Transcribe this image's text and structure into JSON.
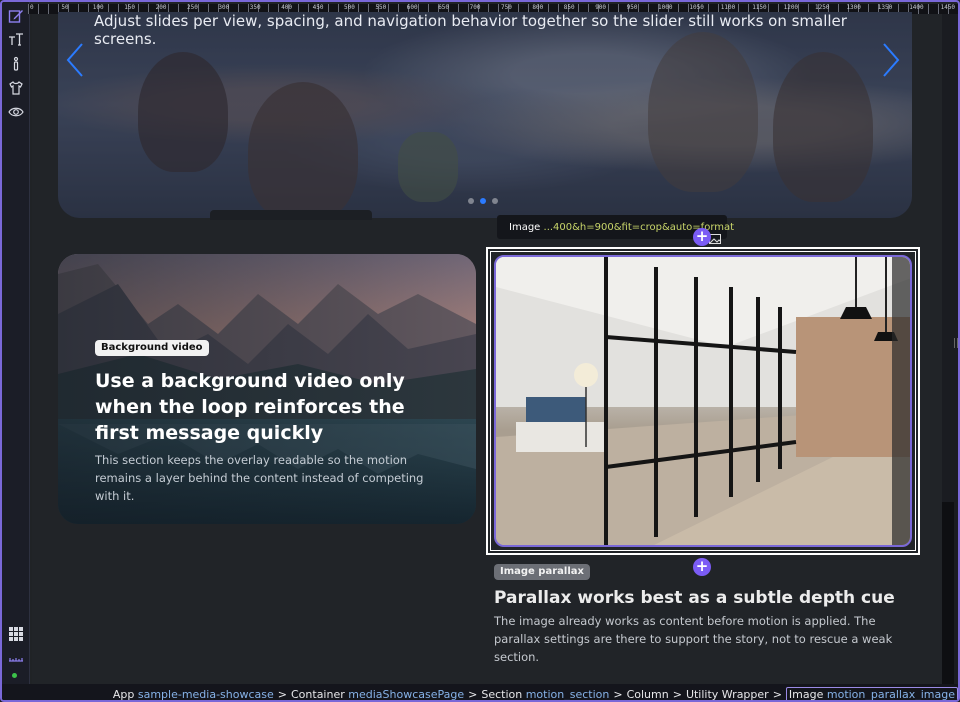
{
  "toolbar": {
    "tools": [
      {
        "icon": "edit-icon"
      },
      {
        "icon": "typography-icon"
      },
      {
        "icon": "info-icon"
      },
      {
        "icon": "shirt-icon"
      },
      {
        "icon": "eye-icon"
      }
    ],
    "bottom_tools": [
      {
        "icon": "grid-icon"
      },
      {
        "icon": "ruler-icon"
      }
    ],
    "accent": "#7a68d8"
  },
  "ruler": {
    "labels": [
      "0",
      "50",
      "100",
      "150",
      "200",
      "250",
      "300",
      "350",
      "400",
      "450",
      "500",
      "550",
      "600",
      "650",
      "700",
      "750",
      "800",
      "850",
      "900",
      "950",
      "1000",
      "1050",
      "1100",
      "1150",
      "1200",
      "1250",
      "1300",
      "1350",
      "1400",
      "1450"
    ]
  },
  "hero": {
    "caption": "Adjust slides per view, spacing, and navigation behavior together so the slider still works on smaller screens.",
    "prev_icon": "chevron-left-icon",
    "next_icon": "chevron-right-icon",
    "arrow_color": "#2b7bff",
    "slides_count": 3,
    "active_slide": 2
  },
  "video_section": {
    "badge": "Background video",
    "title": "Use a background video only when the loop reinforces the first message quickly",
    "text": "This section keeps the overlay readable so the motion remains a layer behind the content instead of competing with it."
  },
  "image_toolbar": {
    "label": "Image",
    "path": "...400&h=900&fit=crop&auto=format",
    "back_icon": "chevron-left-icon",
    "gallery_icon": "image-gallery-icon",
    "path_color": "#c9d66a"
  },
  "add_buttons": {
    "label": "+",
    "color": "#7b5cf5"
  },
  "parallax_section": {
    "badge": "Image parallax",
    "title": "Parallax works best as a subtle depth cue",
    "text": "The image already works as content before motion is applied. The parallax settings are there to support the story, not to rescue a weak section."
  },
  "breadcrumb": {
    "items": [
      {
        "type": "App",
        "name": "sample-media-showcase"
      },
      {
        "type": "Container",
        "name": "mediaShowcasePage"
      },
      {
        "type": "Section",
        "name": "motion_section"
      },
      {
        "type": "Column",
        "name": ""
      },
      {
        "type": "Utility Wrapper",
        "name": ""
      },
      {
        "type": "Image",
        "name": "motion_parallax_image"
      }
    ],
    "separator": ">",
    "link_color": "#86b2e8"
  }
}
